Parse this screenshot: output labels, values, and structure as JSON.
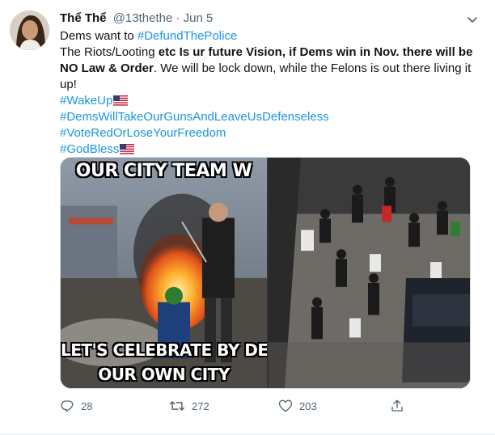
{
  "tweet": {
    "author_name": "Thể Thể",
    "author_handle": "@13thethe",
    "separator": " · ",
    "date": "Jun 5",
    "lines": {
      "l1_text": "Dems want to ",
      "l1_tag": "#DefundThePolice",
      "l2_a": "The Riots/Looting ",
      "l2_bold": "etc Is ur future Vision, if Dems win in Nov. there will be NO Law & Order",
      "l2_b": ". We will be lock down, while the Felons is out there living it up!",
      "tag_wakeup": "#WakeUp",
      "tag_dems": "#DemsWillTakeOurGunsAndLeaveUsDefenseless",
      "tag_vote": "#VoteRedOrLoseYourFreedom",
      "tag_godbless": "#GodBless"
    },
    "media": {
      "meme_top_text": "OUR CITY TEAM W",
      "meme_bottom_text_1": "LET'S CELEBRATE BY DES",
      "meme_bottom_text_2": "OUR OWN CITY"
    },
    "actions": {
      "reply_count": "28",
      "retweet_count": "272",
      "like_count": "203"
    }
  },
  "colors": {
    "link": "#1b95e0",
    "secondary_text": "#536471",
    "primary_text": "#0f1419"
  },
  "icons": [
    "chevron-down-icon",
    "reply-icon",
    "retweet-icon",
    "like-icon",
    "share-icon",
    "us-flag-icon"
  ]
}
